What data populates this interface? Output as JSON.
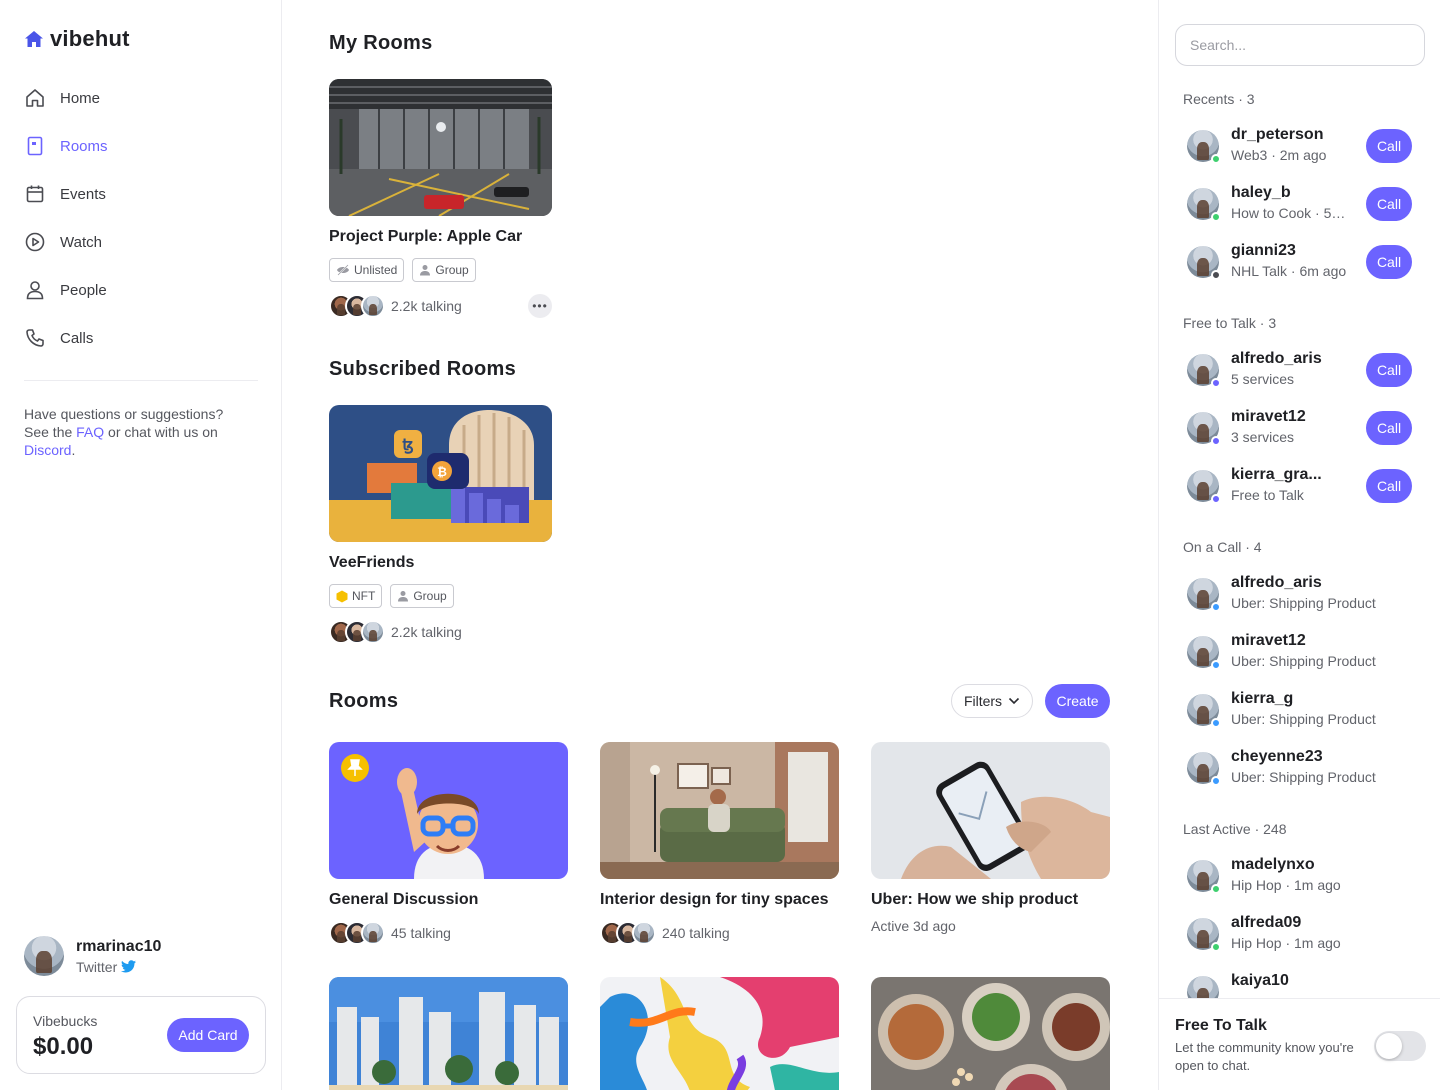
{
  "brand": {
    "name": "vibehut",
    "accent": "#6c63ff"
  },
  "nav": {
    "items": [
      {
        "label": "Home",
        "icon": "home-icon"
      },
      {
        "label": "Rooms",
        "icon": "rooms-icon",
        "active": true
      },
      {
        "label": "Events",
        "icon": "calendar-icon"
      },
      {
        "label": "Watch",
        "icon": "play-icon"
      },
      {
        "label": "People",
        "icon": "person-icon"
      },
      {
        "label": "Calls",
        "icon": "phone-icon"
      }
    ]
  },
  "help": {
    "text1": "Have questions or suggestions? See the ",
    "faq": "FAQ",
    "text2": " or chat with us on ",
    "discord": "Discord",
    "text3": "."
  },
  "me": {
    "username": "rmarinac10",
    "platform": "Twitter"
  },
  "wallet": {
    "label": "Vibebucks",
    "amount": "$0.00",
    "add_card": "Add Card"
  },
  "my_rooms": {
    "heading": "My Rooms",
    "room": {
      "title": "Project Purple: Apple Car",
      "tags": [
        "Unlisted",
        "Group"
      ],
      "talking": "2.2k talking"
    }
  },
  "subscribed_rooms": {
    "heading": "Subscribed Rooms",
    "room": {
      "title": "VeeFriends",
      "tags": [
        "NFT",
        "Group"
      ],
      "talking": "2.2k talking"
    }
  },
  "rooms": {
    "heading": "Rooms",
    "filters": "Filters",
    "create": "Create",
    "cards": [
      {
        "title": "General Discussion",
        "sub": "45 talking"
      },
      {
        "title": "Interior design for tiny spaces",
        "sub": "240 talking"
      },
      {
        "title": "Uber: How we ship product",
        "sub": "Active 3d ago"
      }
    ]
  },
  "right": {
    "search_placeholder": "Search...",
    "call_label": "Call",
    "recents": {
      "heading": "Recents · 3",
      "people": [
        {
          "name": "dr_peterson",
          "desc": "Web3 · 2m ago",
          "status": "#3ecf6e"
        },
        {
          "name": "haley_b",
          "desc": "How to Cook · 5m...",
          "status": "#3ecf6e"
        },
        {
          "name": "gianni23",
          "desc": "NHL Talk · 6m ago",
          "status": "#4b4c52"
        }
      ]
    },
    "free": {
      "heading": "Free to Talk · 3",
      "people": [
        {
          "name": "alfredo_aris",
          "desc": "5 services",
          "status": "#6c63ff"
        },
        {
          "name": "miravet12",
          "desc": "3 services",
          "status": "#6c63ff"
        },
        {
          "name": "kierra_gra...",
          "desc": "Free to Talk",
          "status": "#6c63ff"
        }
      ]
    },
    "on_call": {
      "heading": "On a Call · 4",
      "people": [
        {
          "name": "alfredo_aris",
          "desc": "Uber: Shipping Product",
          "status": "#3b9bff"
        },
        {
          "name": "miravet12",
          "desc": "Uber: Shipping Product",
          "status": "#3b9bff"
        },
        {
          "name": "kierra_g",
          "desc": "Uber: Shipping Product",
          "status": "#3b9bff"
        },
        {
          "name": "cheyenne23",
          "desc": "Uber: Shipping Product",
          "status": "#3b9bff"
        }
      ]
    },
    "last_active": {
      "heading": "Last Active · 248",
      "people": [
        {
          "name": "madelynxo",
          "desc": "Hip Hop · 1m ago",
          "status": "#3ecf6e"
        },
        {
          "name": "alfreda09",
          "desc": "Hip Hop · 1m ago",
          "status": "#3ecf6e"
        },
        {
          "name": "kaiya10",
          "desc": "",
          "status": "#3ecf6e"
        }
      ]
    },
    "free_to_talk": {
      "title": "Free To Talk",
      "desc": "Let the community know you're open to chat.",
      "enabled": false
    }
  }
}
